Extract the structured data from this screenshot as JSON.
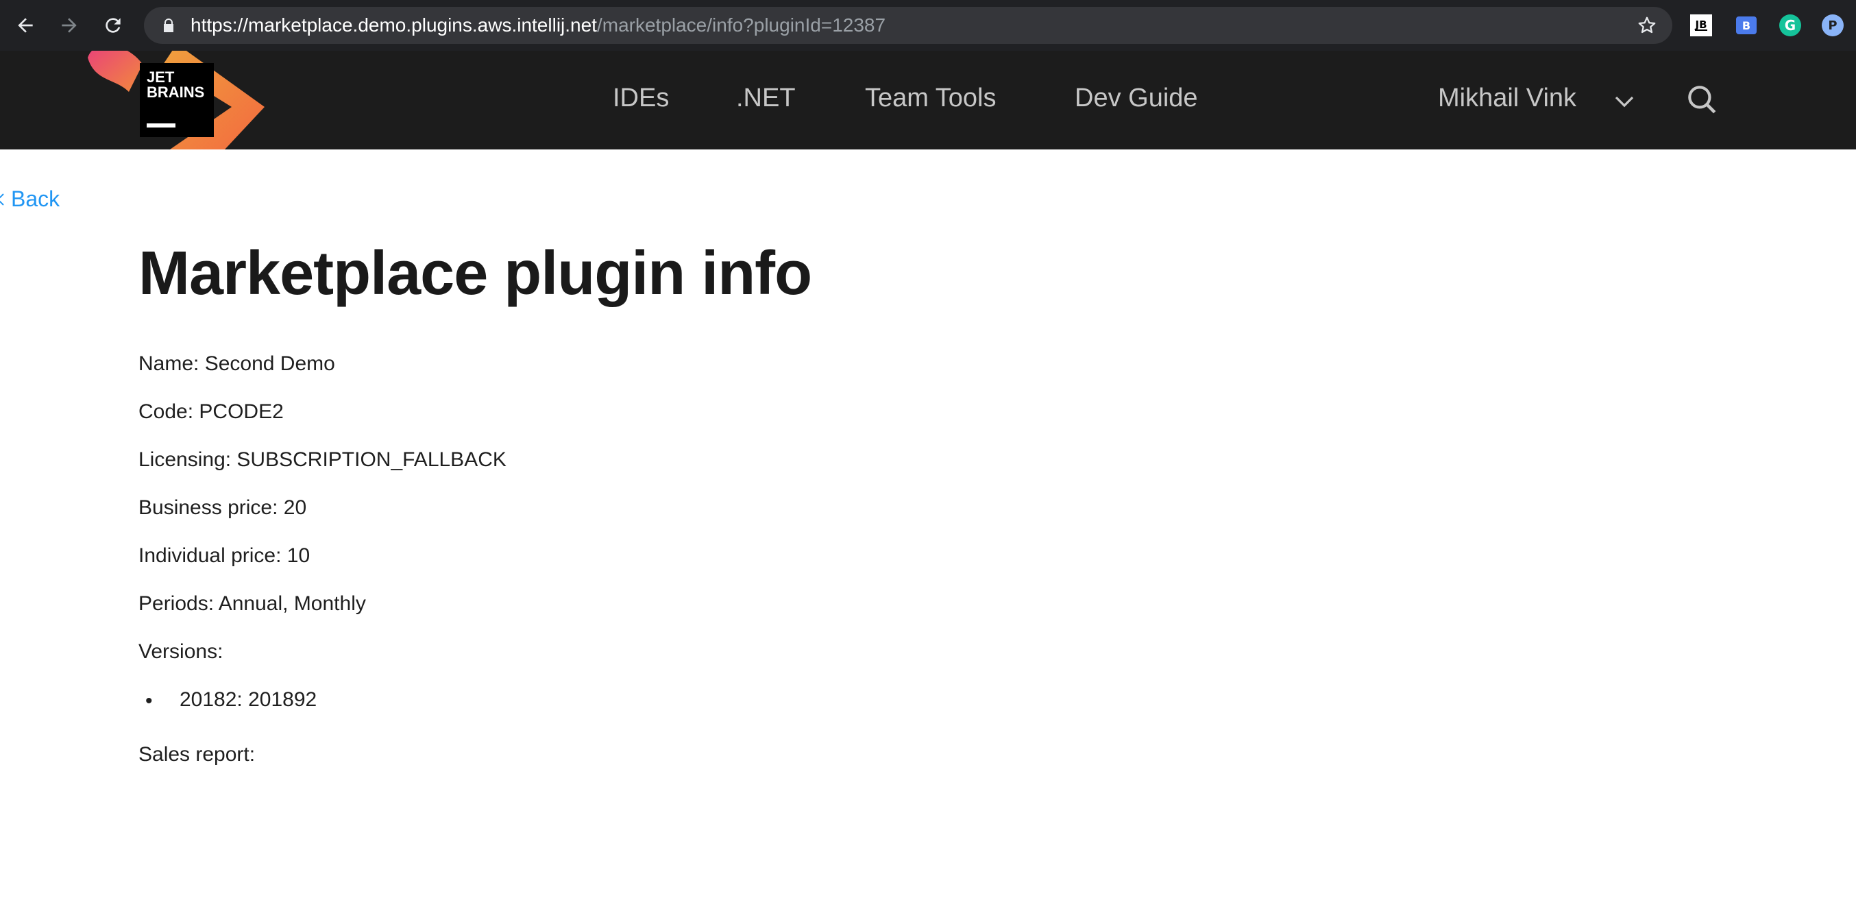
{
  "browser": {
    "url_host": "https://marketplace.demo.plugins.aws.intellij.net",
    "url_path": "/marketplace/info?pluginId=12387",
    "extensions": [
      {
        "name": "jetbrains-extension-icon",
        "label": "JB"
      },
      {
        "name": "bitwarden-extension-icon",
        "label": "B"
      },
      {
        "name": "grammarly-extension-icon",
        "label": "G"
      },
      {
        "name": "profile-extension-icon",
        "label": "P"
      }
    ]
  },
  "header": {
    "logo_text": "JET BRAINS",
    "nav": [
      {
        "label": "IDEs"
      },
      {
        "label": ".NET"
      },
      {
        "label": "Team Tools"
      },
      {
        "label": "Dev Guide"
      }
    ],
    "user_name": "Mikhail Vink"
  },
  "content": {
    "back_label": "Back",
    "title": "Marketplace plugin info",
    "name": "Name: Second Demo",
    "code": "Code: PCODE2",
    "licensing": "Licensing: SUBSCRIPTION_FALLBACK",
    "business_price": "Business price: 20",
    "individual_price": "Individual price: 10",
    "periods": "Periods: Annual, Monthly",
    "versions_label": "Versions:",
    "versions": [
      {
        "text": "20182: 201892"
      }
    ],
    "sales_report_label": "Sales report:"
  },
  "colors": {
    "header_bg": "#1c1c1c",
    "browser_bg": "#202124",
    "link": "#2196f3",
    "title": "#1a1a1a"
  }
}
